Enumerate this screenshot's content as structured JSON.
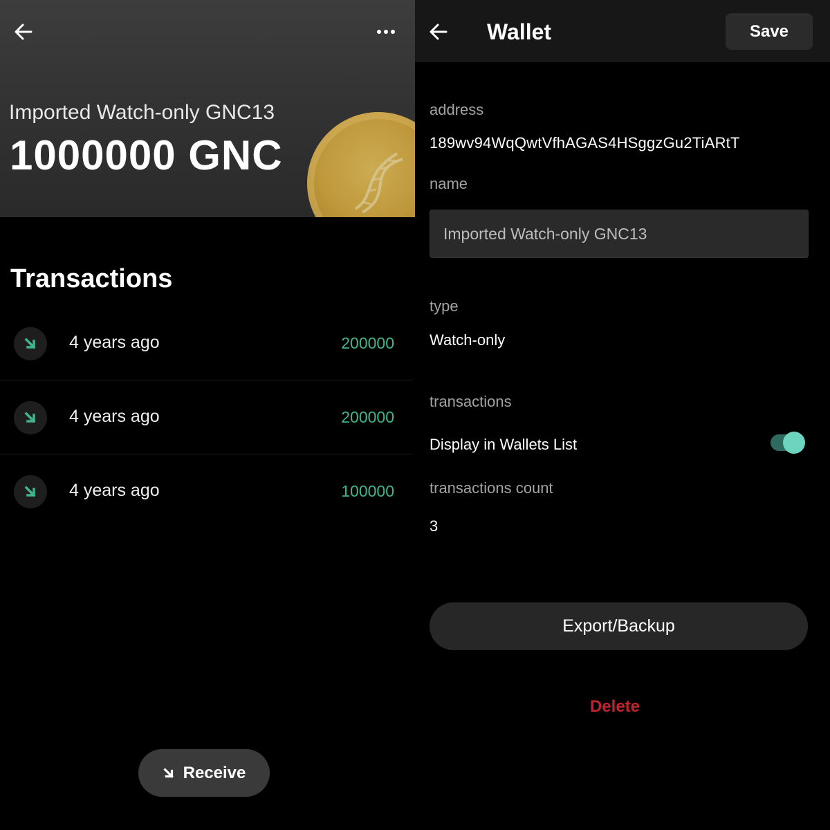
{
  "wallet_view": {
    "name": "Imported Watch-only GNC13",
    "balance": "1000000 GNC",
    "transactions_title": "Transactions",
    "transactions": [
      {
        "time": "4 years ago",
        "amount": "200000"
      },
      {
        "time": "4 years ago",
        "amount": "200000"
      },
      {
        "time": "4 years ago",
        "amount": "100000"
      }
    ],
    "receive_label": "Receive"
  },
  "wallet_details": {
    "title": "Wallet",
    "save_label": "Save",
    "address_label": "address",
    "address_value": "189wv94WqQwtVfhAGAS4HSggzGu2TiARtT",
    "name_label": "name",
    "name_value": "Imported Watch-only GNC13",
    "type_label": "type",
    "type_value": "Watch-only",
    "transactions_label": "transactions",
    "display_in_list_label": "Display in Wallets List",
    "display_in_list_enabled": true,
    "tx_count_label": "transactions count",
    "tx_count_value": "3",
    "export_label": "Export/Backup",
    "delete_label": "Delete"
  },
  "icons": {
    "back": "arrow-left-icon",
    "more": "more-horizontal-icon",
    "incoming": "arrow-down-right-icon",
    "coin": "dna-coin-icon"
  },
  "colors": {
    "accent_green": "#3fb58f",
    "toggle_on": "#6dd4c0",
    "delete_red": "#c0232e"
  }
}
